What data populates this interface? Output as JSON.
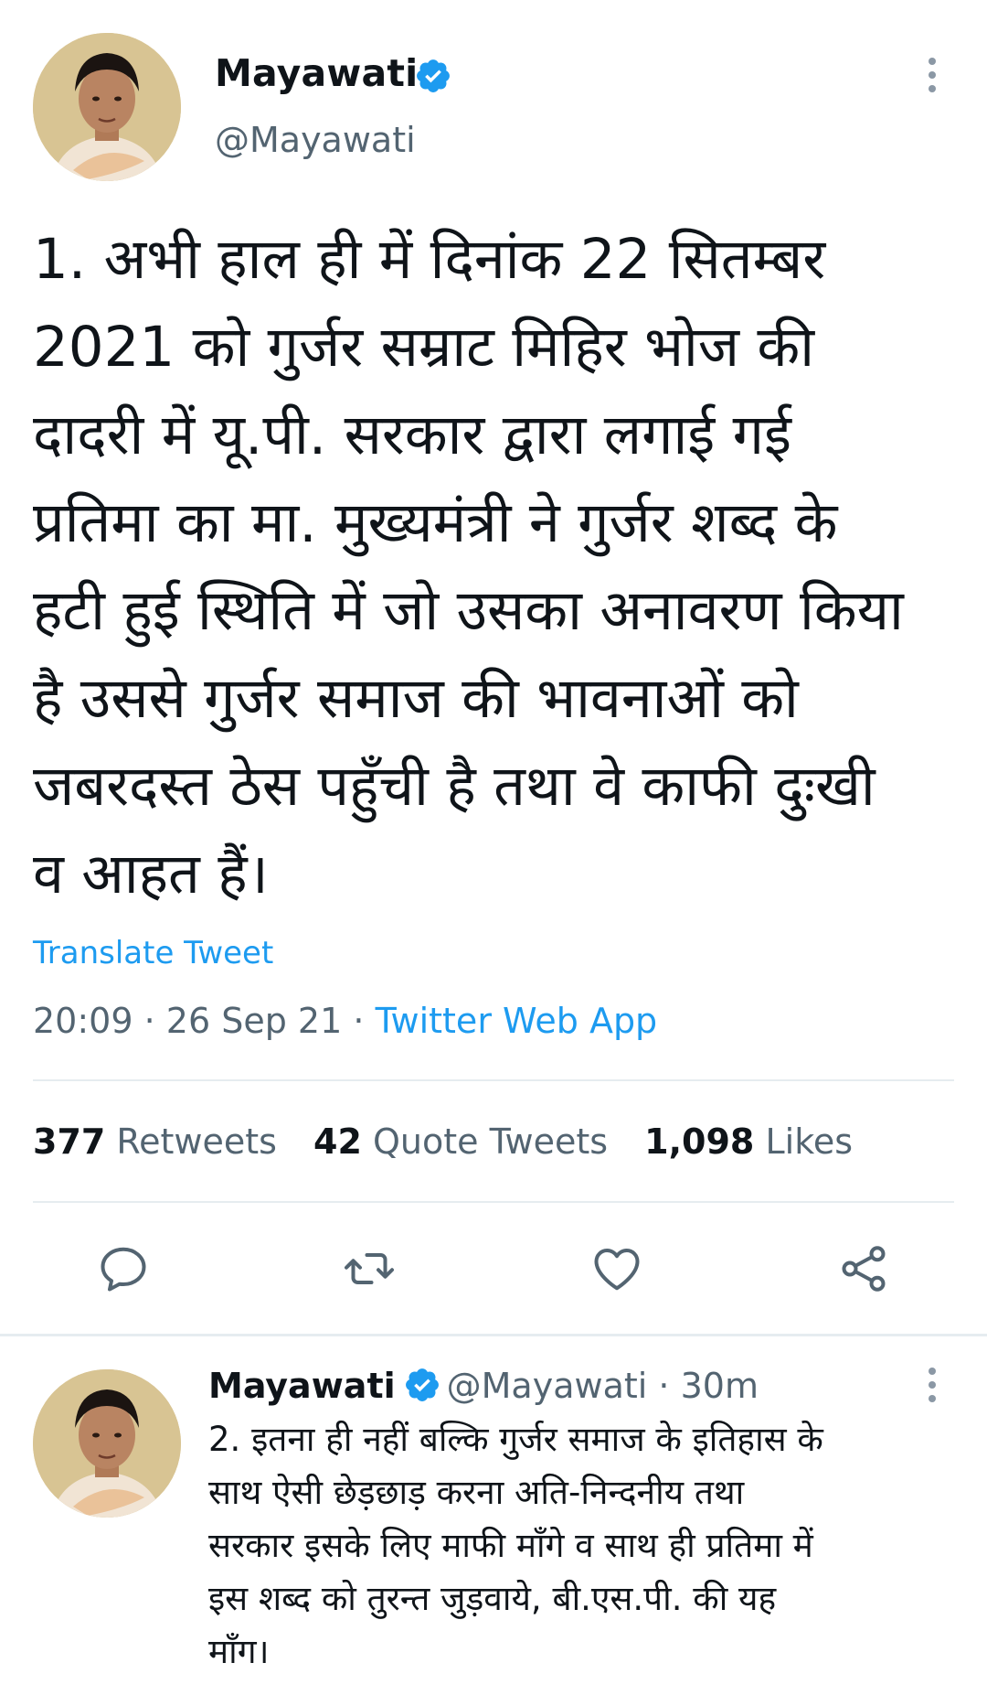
{
  "main_tweet": {
    "author_name": "Mayawati",
    "author_handle": "@Mayawati",
    "verified_icon": "verified-badge-icon",
    "text": "1. अभी हाल ही में दिनांक 22 सितम्बर\n2021 को गुर्जर सम्राट मिहिर भोज की\nदादरी में यू.पी. सरकार द्वारा लगाई गई\nप्रतिमा का मा. मुख्यमंत्री ने गुर्जर शब्द के\nहटी हुई स्थिति में जो उसका अनावरण किया\nहै उससे गुर्जर समाज की भावनाओं को\nजबरदस्त ठेस पहुँची है तथा वे काफी दुःखी\nव आहत हैं।",
    "translate_label": "Translate Tweet",
    "time": "20:09",
    "date": "26 Sep 21",
    "separator": "·",
    "source": "Twitter Web App",
    "stats": {
      "retweets_count": "377",
      "retweets_label": "Retweets",
      "quotes_count": "42",
      "quotes_label": "Quote Tweets",
      "likes_count": "1,098",
      "likes_label": "Likes"
    },
    "actions": [
      "reply-icon",
      "retweet-icon",
      "like-icon",
      "share-icon"
    ]
  },
  "reply_tweet": {
    "author_name": "Mayawati",
    "author_handle": "@Mayawati",
    "separator": "·",
    "time_ago": "30m",
    "text": "2. इतना ही नहीं बल्कि गुर्जर समाज के इतिहास के\nसाथ ऐसी छेड़छाड़ करना अति-निन्दनीय तथा\nसरकार इसके लिए माफी माँगे व साथ ही प्रतिमा में\nइस शब्द को तुरन्त जुड़वाये, बी.एस.पी. की यह\nमाँग।"
  },
  "colors": {
    "link_blue": "#1d9bf0",
    "secondary_text": "#536471",
    "divider": "#e6ecf0"
  }
}
